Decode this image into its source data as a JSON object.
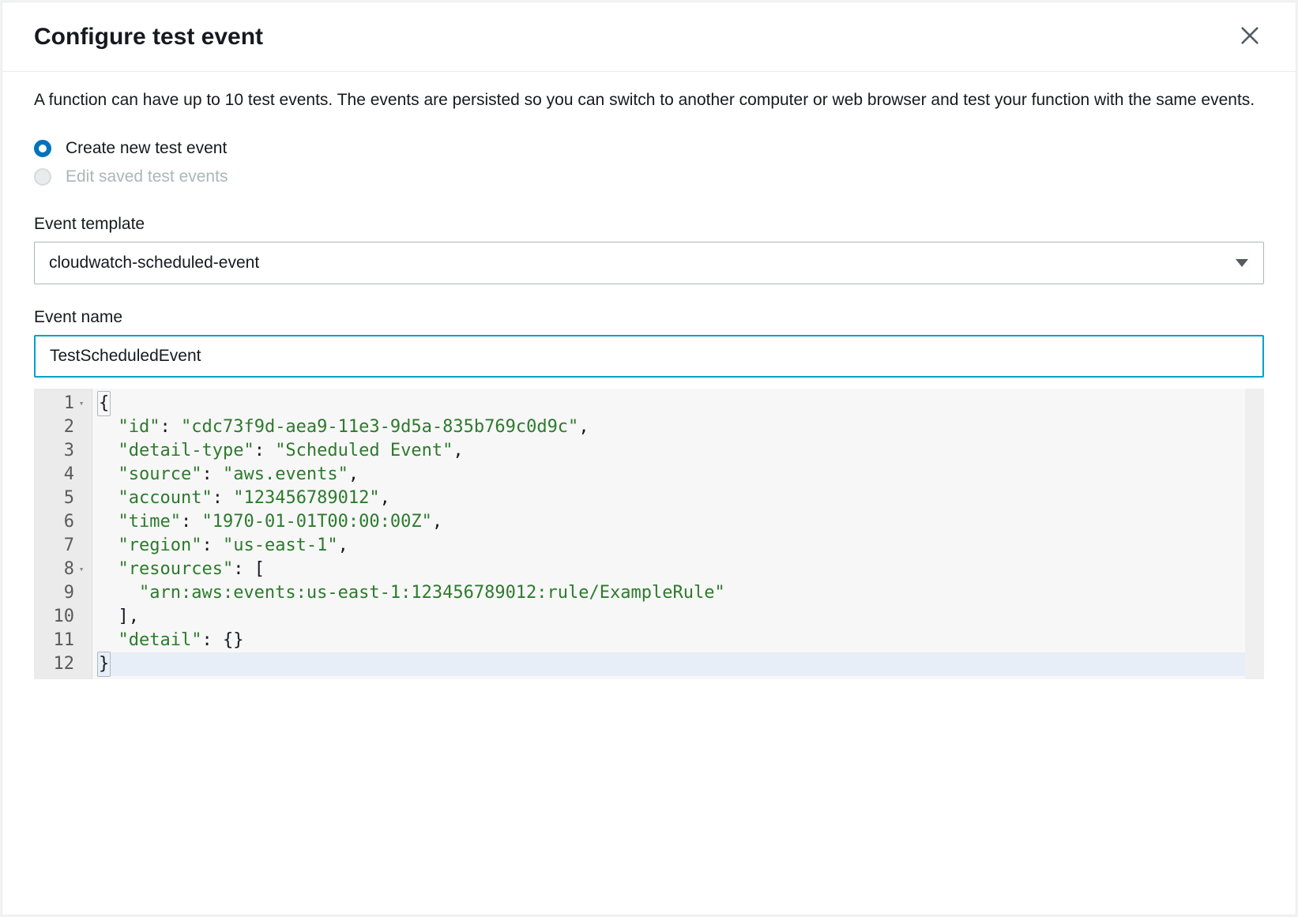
{
  "header": {
    "title": "Configure test event"
  },
  "description": "A function can have up to 10 test events. The events are persisted so you can switch to another computer or web browser and test your function with the same events.",
  "radios": {
    "create": "Create new test event",
    "edit": "Edit saved test events"
  },
  "template": {
    "label": "Event template",
    "value": "cloudwatch-scheduled-event"
  },
  "event_name": {
    "label": "Event name",
    "value": "TestScheduledEvent"
  },
  "code": {
    "lines": [
      {
        "n": "1",
        "fold": "▾",
        "tokens": [
          {
            "t": "{",
            "c": "brace-match"
          }
        ]
      },
      {
        "n": "2",
        "fold": "",
        "tokens": [
          {
            "t": "  "
          },
          {
            "t": "\"id\"",
            "c": "tok-key"
          },
          {
            "t": ": "
          },
          {
            "t": "\"cdc73f9d-aea9-11e3-9d5a-835b769c0d9c\"",
            "c": "tok-str"
          },
          {
            "t": ","
          }
        ]
      },
      {
        "n": "3",
        "fold": "",
        "tokens": [
          {
            "t": "  "
          },
          {
            "t": "\"detail-type\"",
            "c": "tok-key"
          },
          {
            "t": ": "
          },
          {
            "t": "\"Scheduled Event\"",
            "c": "tok-str"
          },
          {
            "t": ","
          }
        ]
      },
      {
        "n": "4",
        "fold": "",
        "tokens": [
          {
            "t": "  "
          },
          {
            "t": "\"source\"",
            "c": "tok-key"
          },
          {
            "t": ": "
          },
          {
            "t": "\"aws.events\"",
            "c": "tok-str"
          },
          {
            "t": ","
          }
        ]
      },
      {
        "n": "5",
        "fold": "",
        "tokens": [
          {
            "t": "  "
          },
          {
            "t": "\"account\"",
            "c": "tok-key"
          },
          {
            "t": ": "
          },
          {
            "t": "\"123456789012\"",
            "c": "tok-str"
          },
          {
            "t": ","
          }
        ]
      },
      {
        "n": "6",
        "fold": "",
        "tokens": [
          {
            "t": "  "
          },
          {
            "t": "\"time\"",
            "c": "tok-key"
          },
          {
            "t": ": "
          },
          {
            "t": "\"1970-01-01T00:00:00Z\"",
            "c": "tok-str"
          },
          {
            "t": ","
          }
        ]
      },
      {
        "n": "7",
        "fold": "",
        "tokens": [
          {
            "t": "  "
          },
          {
            "t": "\"region\"",
            "c": "tok-key"
          },
          {
            "t": ": "
          },
          {
            "t": "\"us-east-1\"",
            "c": "tok-str"
          },
          {
            "t": ","
          }
        ]
      },
      {
        "n": "8",
        "fold": "▾",
        "tokens": [
          {
            "t": "  "
          },
          {
            "t": "\"resources\"",
            "c": "tok-key"
          },
          {
            "t": ": ["
          }
        ]
      },
      {
        "n": "9",
        "fold": "",
        "tokens": [
          {
            "t": "    "
          },
          {
            "t": "\"arn:aws:events:us-east-1:123456789012:rule/ExampleRule\"",
            "c": "tok-str"
          }
        ]
      },
      {
        "n": "10",
        "fold": "",
        "tokens": [
          {
            "t": "  ],"
          }
        ]
      },
      {
        "n": "11",
        "fold": "",
        "tokens": [
          {
            "t": "  "
          },
          {
            "t": "\"detail\"",
            "c": "tok-key"
          },
          {
            "t": ": {}"
          }
        ]
      },
      {
        "n": "12",
        "fold": "",
        "active": true,
        "tokens": [
          {
            "t": "}",
            "c": "brace-match"
          }
        ]
      }
    ]
  }
}
